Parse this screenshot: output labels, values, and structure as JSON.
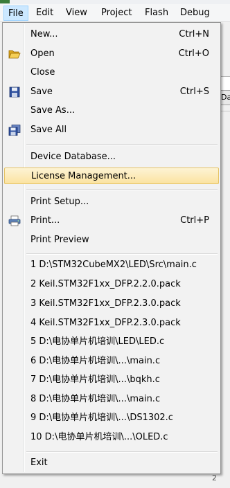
{
  "menubar": {
    "items": [
      {
        "label": "File"
      },
      {
        "label": "Edit"
      },
      {
        "label": "View"
      },
      {
        "label": "Project"
      },
      {
        "label": "Flash"
      },
      {
        "label": "Debug"
      }
    ]
  },
  "background": {
    "tab_label": "Da",
    "bottom_num": "2"
  },
  "file_menu": {
    "items": [
      {
        "label": "New...",
        "shortcut": "Ctrl+N"
      },
      {
        "label": "Open",
        "shortcut": "Ctrl+O"
      },
      {
        "label": "Close"
      },
      {
        "label": "Save",
        "shortcut": "Ctrl+S"
      },
      {
        "label": "Save As..."
      },
      {
        "label": "Save All"
      },
      {
        "label": "Device Database..."
      },
      {
        "label": "License Management..."
      },
      {
        "label": "Print Setup..."
      },
      {
        "label": "Print...",
        "shortcut": "Ctrl+P"
      },
      {
        "label": "Print Preview"
      },
      {
        "label": "1 D:\\STM32CubeMX2\\LED\\Src\\main.c"
      },
      {
        "label": "2 Keil.STM32F1xx_DFP.2.2.0.pack"
      },
      {
        "label": "3 Keil.STM32F1xx_DFP.2.3.0.pack"
      },
      {
        "label": "4 Keil.STM32F1xx_DFP.2.3.0.pack"
      },
      {
        "label": "5 D:\\电协单片机培训\\LED\\LED.c"
      },
      {
        "label": "6 D:\\电协单片机培训\\...\\main.c"
      },
      {
        "label": "7 D:\\电协单片机培训\\...\\bqkh.c"
      },
      {
        "label": "8 D:\\电协单片机培训\\...\\main.c"
      },
      {
        "label": "9 D:\\电协单片机培训\\...\\DS1302.c"
      },
      {
        "label": "10 D:\\电协单片机培训\\...\\OLED.c"
      },
      {
        "label": "Exit"
      }
    ],
    "icons": {
      "open": "folder-open-icon",
      "save": "floppy-disk-icon",
      "save_all": "save-all-icon",
      "print": "printer-icon"
    }
  }
}
